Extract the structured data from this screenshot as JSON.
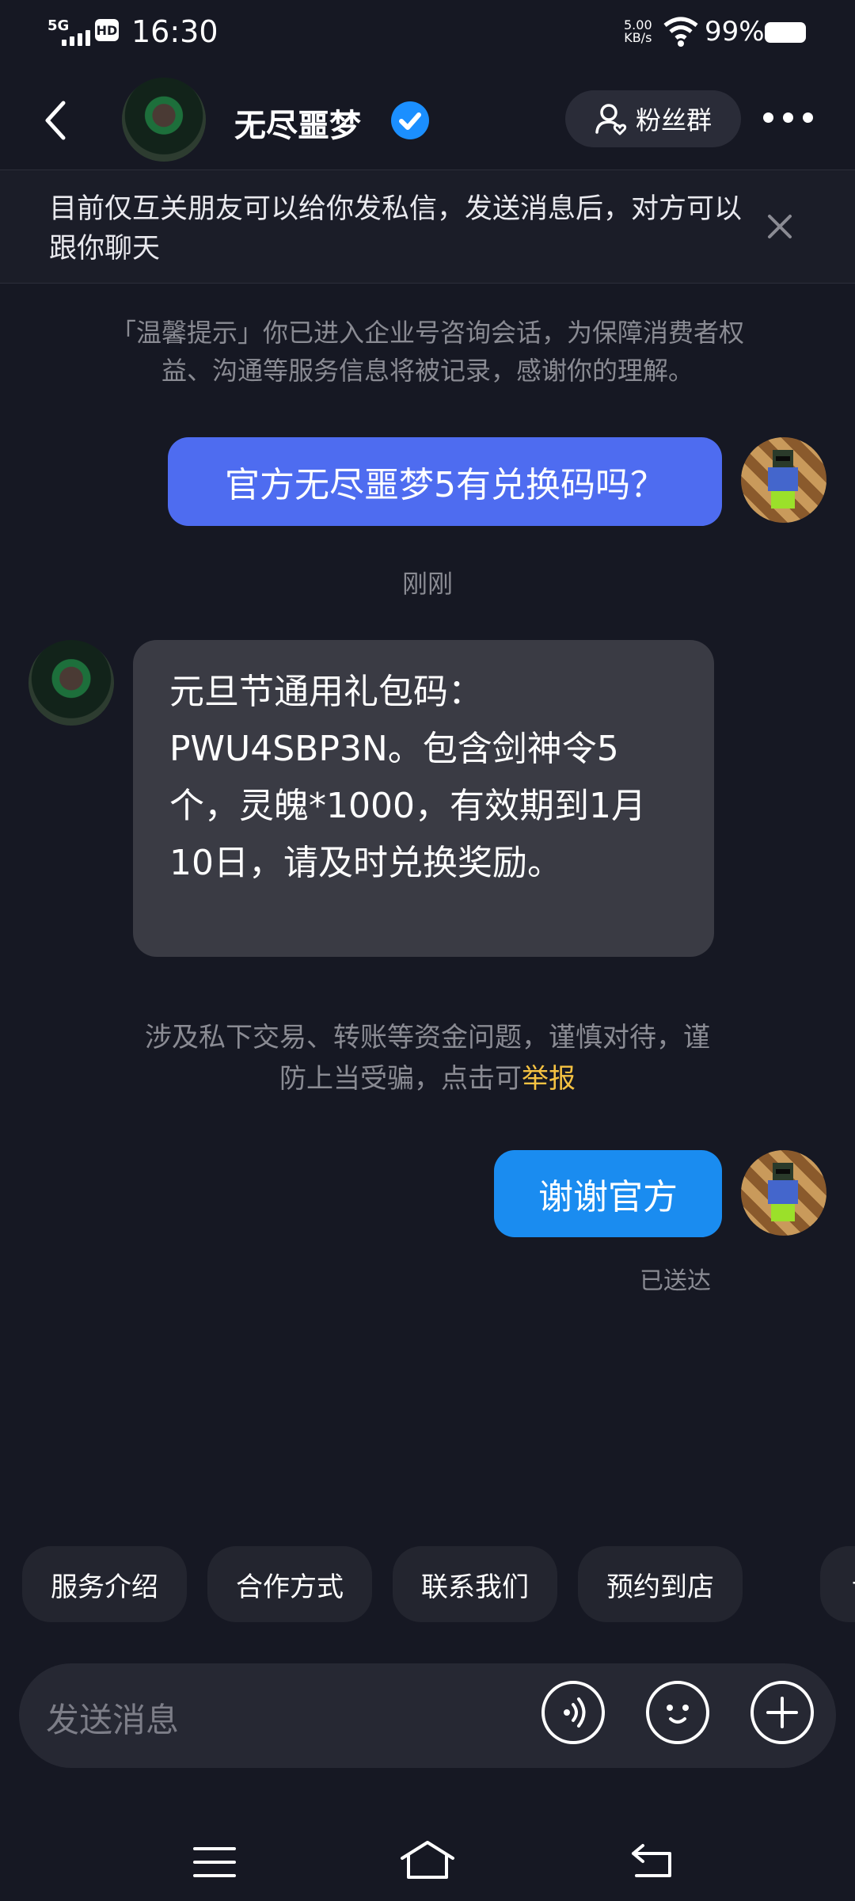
{
  "status_bar": {
    "network": "5G",
    "hd_badge": "HD",
    "time": "16:30",
    "speed_value": "5.00",
    "speed_unit": "KB/s",
    "battery": "99%"
  },
  "header": {
    "title": "无尽噩梦",
    "fans_label": "粉丝群"
  },
  "notice": {
    "text": "目前仅互关朋友可以给你发私信，发送消息后，对方可以跟你聊天"
  },
  "tip": "「温馨提示」你已进入企业号咨询会话，为保障消费者权益、沟通等服务信息将被记录，感谢你的理解。",
  "messages": [
    {
      "text": "官方无尽噩梦5有兑换码吗？"
    },
    {
      "timestamp": "刚刚"
    },
    {
      "text": "元旦节通用礼包码：PWU4SBP3N。包含剑神令5个，灵魄*1000，有效期到1月10日，请及时兑换奖励。"
    },
    {
      "warning": "涉及私下交易、转账等资金问题，谨慎对待，谨防上当受骗，点击可",
      "link": "举报"
    },
    {
      "text": "谢谢官方",
      "status": "已送达"
    }
  ],
  "quick_replies": [
    "服务介绍",
    "合作方式",
    "联系我们",
    "预约到店",
    "让"
  ],
  "input": {
    "placeholder": "发送消息"
  },
  "colors": {
    "background": "#161823",
    "sent_bubble_1": "#4e6cf0",
    "sent_bubble_2": "#1a8cf0",
    "received_bubble": "#3a3b44",
    "link": "#f5c242",
    "verified": "#1b8fff"
  },
  "icons": [
    "back-icon",
    "verified-icon",
    "fans-group-icon",
    "more-icon",
    "close-icon",
    "voice-icon",
    "emoji-icon",
    "plus-icon",
    "menu-icon",
    "home-icon",
    "return-icon"
  ]
}
